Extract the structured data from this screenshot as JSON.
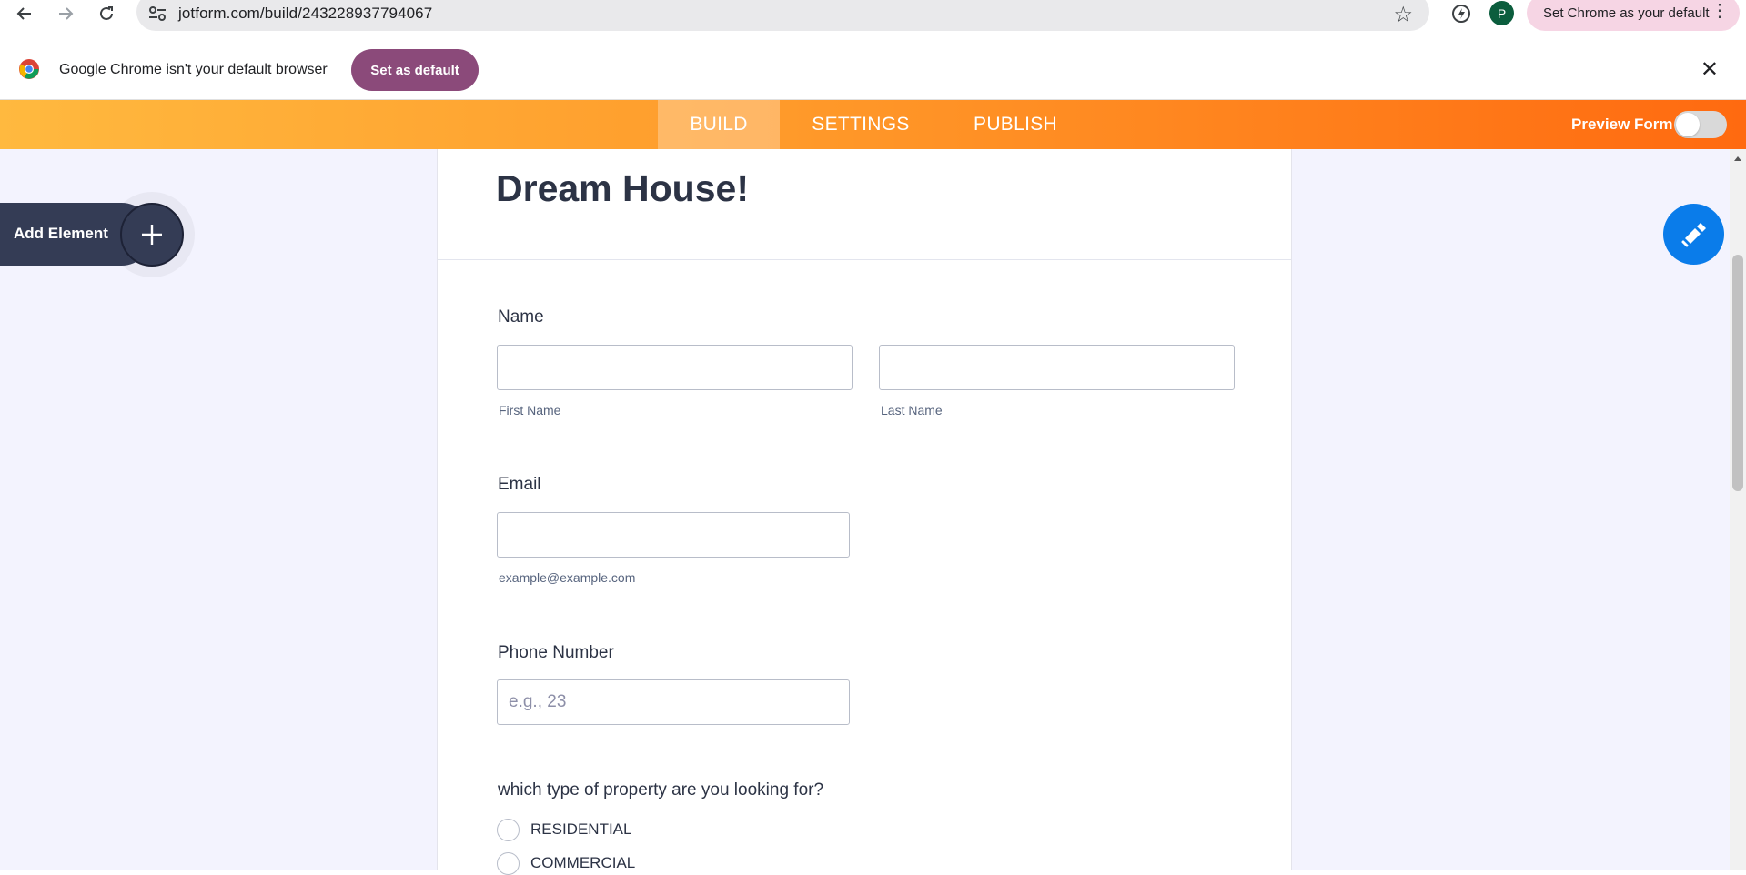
{
  "browser": {
    "url": "jotform.com/build/243228937794067",
    "set_default_chip": "Set Chrome as your default",
    "profile_initial": "P"
  },
  "infobar": {
    "message": "Google Chrome isn't your default browser",
    "button": "Set as default"
  },
  "nav": {
    "tabs": [
      "BUILD",
      "SETTINGS",
      "PUBLISH"
    ],
    "active_tab": "BUILD",
    "preview_label": "Preview Form",
    "preview_enabled": false
  },
  "sidebar": {
    "add_element": "Add Element"
  },
  "form": {
    "title": "Dream House!",
    "name": {
      "label": "Name",
      "first_sublabel": "First Name",
      "last_sublabel": "Last Name"
    },
    "email": {
      "label": "Email",
      "sublabel": "example@example.com"
    },
    "phone": {
      "label": "Phone Number",
      "placeholder": "e.g., 23"
    },
    "property": {
      "label": "which type of property are you looking for?",
      "options": [
        "RESIDENTIAL",
        "COMMERCIAL"
      ]
    }
  },
  "colors": {
    "nav_gradient_start": "#ffb93f",
    "nav_gradient_end": "#ff6a10",
    "add_element_bg": "#343c55",
    "paint_button": "#0a7cea",
    "set_default_button": "#8b4a7a",
    "workarea_bg": "#f3f3fe"
  },
  "icons": {
    "back": "arrow-left-icon",
    "forward": "arrow-right-icon",
    "reload": "reload-icon",
    "site_info": "tune-icon",
    "bookmark": "star-icon",
    "extension": "extension-icon",
    "menu": "vertical-dots-icon",
    "close": "close-icon",
    "add": "plus-icon",
    "designer": "paint-roller-icon"
  }
}
